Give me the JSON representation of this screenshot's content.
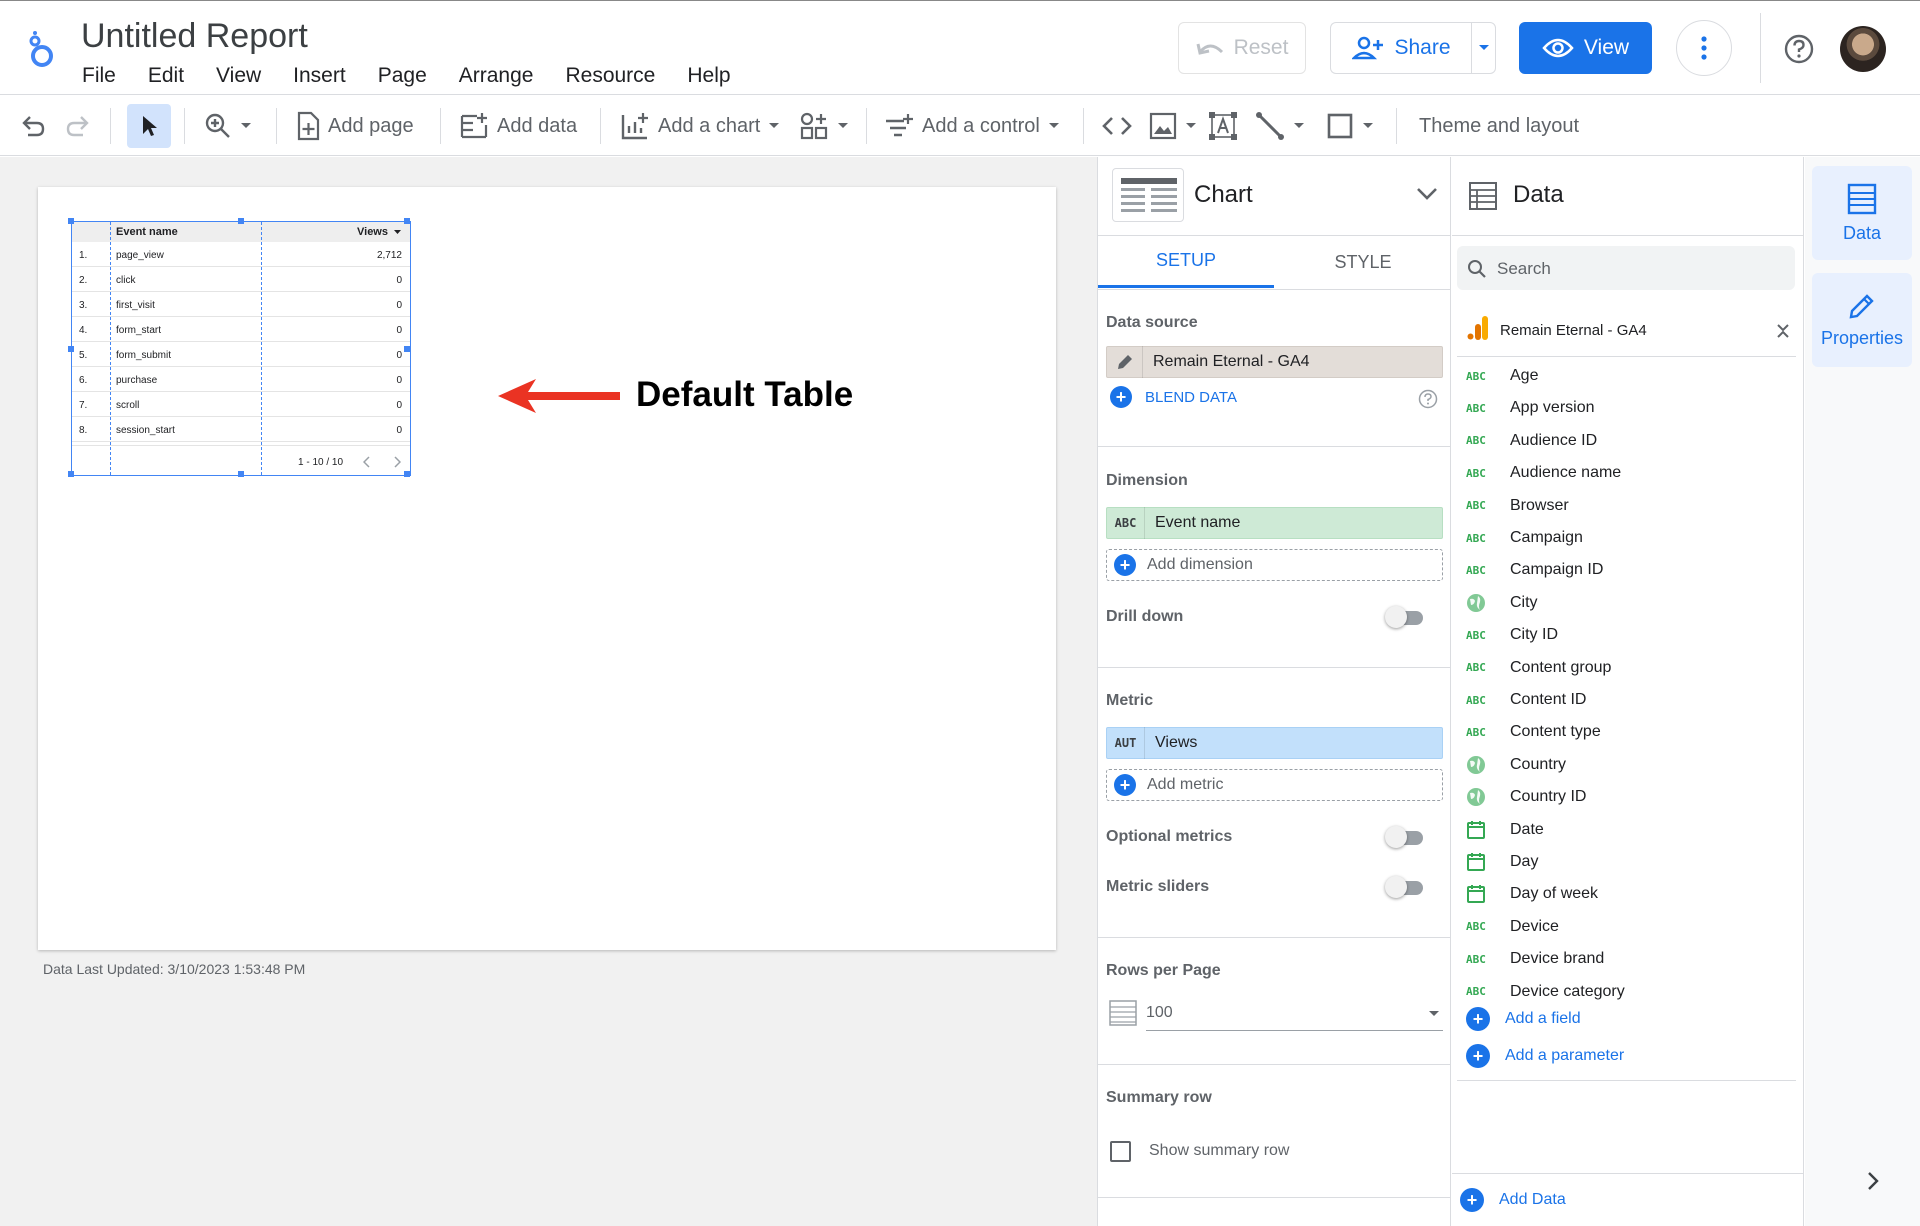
{
  "header": {
    "title": "Untitled Report",
    "menu": [
      "File",
      "Edit",
      "View",
      "Insert",
      "Page",
      "Arrange",
      "Resource",
      "Help"
    ],
    "reset_label": "Reset",
    "share_label": "Share",
    "view_label": "View"
  },
  "toolbar": {
    "add_page": "Add page",
    "add_data": "Add data",
    "add_chart": "Add a chart",
    "add_control": "Add a control",
    "theme": "Theme and layout"
  },
  "canvas": {
    "last_updated": "Data Last Updated: 3/10/2023 1:53:48 PM",
    "annotation": "Default Table",
    "table": {
      "col_dimension": "Event name",
      "col_metric": "Views",
      "rows": [
        {
          "n": "1.",
          "name": "page_view",
          "value": "2,712"
        },
        {
          "n": "2.",
          "name": "click",
          "value": "0"
        },
        {
          "n": "3.",
          "name": "first_visit",
          "value": "0"
        },
        {
          "n": "4.",
          "name": "form_start",
          "value": "0"
        },
        {
          "n": "5.",
          "name": "form_submit",
          "value": "0"
        },
        {
          "n": "6.",
          "name": "purchase",
          "value": "0"
        },
        {
          "n": "7.",
          "name": "scroll",
          "value": "0"
        },
        {
          "n": "8.",
          "name": "session_start",
          "value": "0"
        }
      ],
      "pagination": "1 - 10 / 10"
    }
  },
  "chart_panel": {
    "title": "Chart",
    "tab_setup": "SETUP",
    "tab_style": "STYLE",
    "data_source_label": "Data source",
    "data_source": "Remain Eternal - GA4",
    "blend_data": "BLEND DATA",
    "dimension_label": "Dimension",
    "dimension_tag": "ABC",
    "dimension_value": "Event name",
    "add_dimension": "Add dimension",
    "drill_down": "Drill down",
    "metric_label": "Metric",
    "metric_tag": "AUT",
    "metric_value": "Views",
    "add_metric": "Add metric",
    "optional_metrics": "Optional metrics",
    "metric_sliders": "Metric sliders",
    "rows_per_page_label": "Rows per Page",
    "rows_per_page": "100",
    "summary_row_label": "Summary row",
    "show_summary_row": "Show summary row"
  },
  "data_panel": {
    "title": "Data",
    "search_placeholder": "Search",
    "source": "Remain Eternal - GA4",
    "fields": [
      {
        "type": "ABC",
        "name": "Age"
      },
      {
        "type": "ABC",
        "name": "App version"
      },
      {
        "type": "ABC",
        "name": "Audience ID"
      },
      {
        "type": "ABC",
        "name": "Audience name"
      },
      {
        "type": "ABC",
        "name": "Browser"
      },
      {
        "type": "ABC",
        "name": "Campaign"
      },
      {
        "type": "ABC",
        "name": "Campaign ID"
      },
      {
        "type": "geo",
        "name": "City"
      },
      {
        "type": "ABC",
        "name": "City ID"
      },
      {
        "type": "ABC",
        "name": "Content group"
      },
      {
        "type": "ABC",
        "name": "Content ID"
      },
      {
        "type": "ABC",
        "name": "Content type"
      },
      {
        "type": "geo",
        "name": "Country"
      },
      {
        "type": "geo",
        "name": "Country ID"
      },
      {
        "type": "date",
        "name": "Date"
      },
      {
        "type": "date",
        "name": "Day"
      },
      {
        "type": "date",
        "name": "Day of week"
      },
      {
        "type": "ABC",
        "name": "Device"
      },
      {
        "type": "ABC",
        "name": "Device brand"
      },
      {
        "type": "ABC",
        "name": "Device category"
      }
    ],
    "add_field": "Add a field",
    "add_parameter": "Add a parameter",
    "add_data": "Add Data"
  },
  "rail": {
    "data": "Data",
    "properties": "Properties"
  },
  "colors": {
    "accent": "#1a73e8",
    "dimension_chip": "#ceead6",
    "metric_chip": "#c2e0fb",
    "arrow": "#ea3323"
  }
}
